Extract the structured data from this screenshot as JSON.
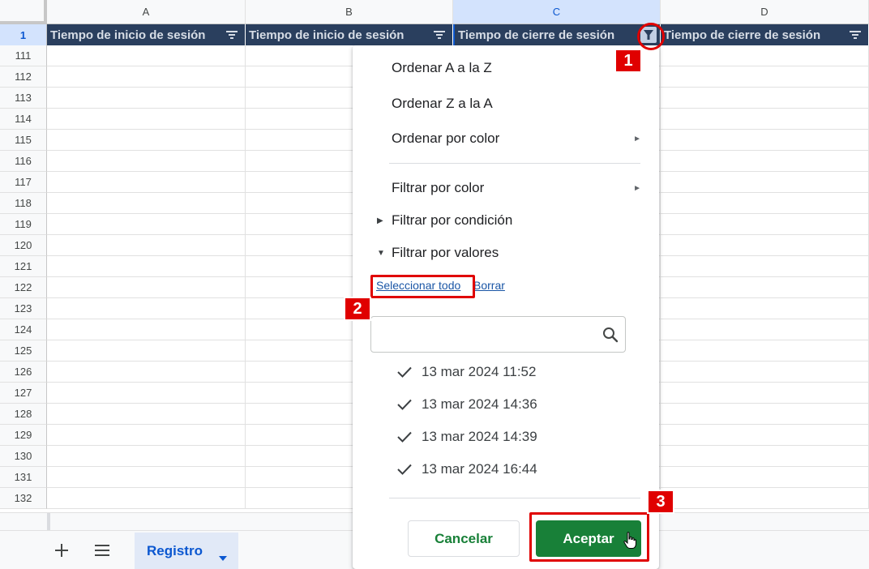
{
  "columns": [
    {
      "letter": "A",
      "header": "Tiempo de inicio de sesión"
    },
    {
      "letter": "B",
      "header": "Tiempo de inicio de sesión"
    },
    {
      "letter": "C",
      "header": "Tiempo de cierre de sesión"
    },
    {
      "letter": "D",
      "header": "Tiempo de cierre de sesión"
    }
  ],
  "header_row_number": "1",
  "row_numbers": [
    "111",
    "112",
    "113",
    "114",
    "115",
    "116",
    "117",
    "118",
    "119",
    "120",
    "121",
    "122",
    "123",
    "124",
    "125",
    "126",
    "127",
    "128",
    "129",
    "130",
    "131",
    "132"
  ],
  "colors": {
    "header_bg": "#2a3f5e",
    "header_text": "#d7dde6",
    "selection": "#d3e3fd",
    "accent_blue": "#0b57d0",
    "button_green": "#188038",
    "annotation_red": "#e00000"
  },
  "filter_menu": {
    "sort_az": "Ordenar A a la Z",
    "sort_za": "Ordenar Z a la A",
    "sort_by_color": "Ordenar por color",
    "filter_by_color": "Filtrar por color",
    "filter_by_condition": "Filtrar por condición",
    "filter_by_values": "Filtrar por valores",
    "select_all": "Seleccionar todo",
    "clear": "Borrar",
    "search_value": "",
    "values": [
      {
        "label": "13 mar 2024 11:52",
        "checked": true
      },
      {
        "label": "13 mar 2024 14:36",
        "checked": true
      },
      {
        "label": "13 mar 2024 14:39",
        "checked": true
      },
      {
        "label": "13 mar 2024 16:44",
        "checked": true
      }
    ],
    "cancel_label": "Cancelar",
    "ok_label": "Aceptar"
  },
  "sheet_bar": {
    "add_icon": "plus-icon",
    "list_icon": "menu-icon",
    "active_sheet": "Registro"
  },
  "annotations": {
    "step1": "1",
    "step2": "2",
    "step3": "3"
  }
}
